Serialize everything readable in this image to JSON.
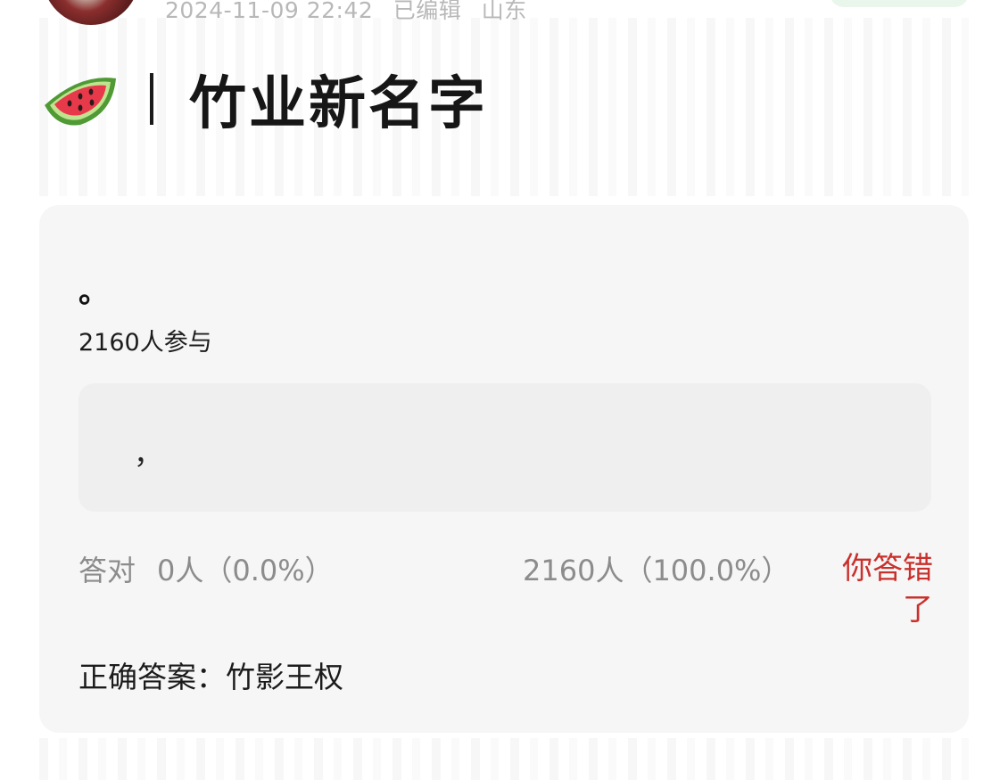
{
  "header": {
    "timestamp": "2024-11-09 22:42",
    "edited_label": "已编辑",
    "location": "山东"
  },
  "topic": {
    "emoji_icon": "watermelon-icon",
    "divider": "|",
    "title": "竹业新名字"
  },
  "quiz": {
    "question": "。",
    "participants": "2160人参与",
    "option_text": "，",
    "correct_label": "答对",
    "correct_count": "0人（0.0%）",
    "wrong_count": "2160人（100.0%）",
    "result_text": "你答错了",
    "answer_line": "正确答案：竹影王权"
  },
  "colors": {
    "card_bg": "#f6f6f6",
    "option_bg": "#efefef",
    "wrong_red": "#c9302c",
    "muted": "#8c8c8c"
  }
}
